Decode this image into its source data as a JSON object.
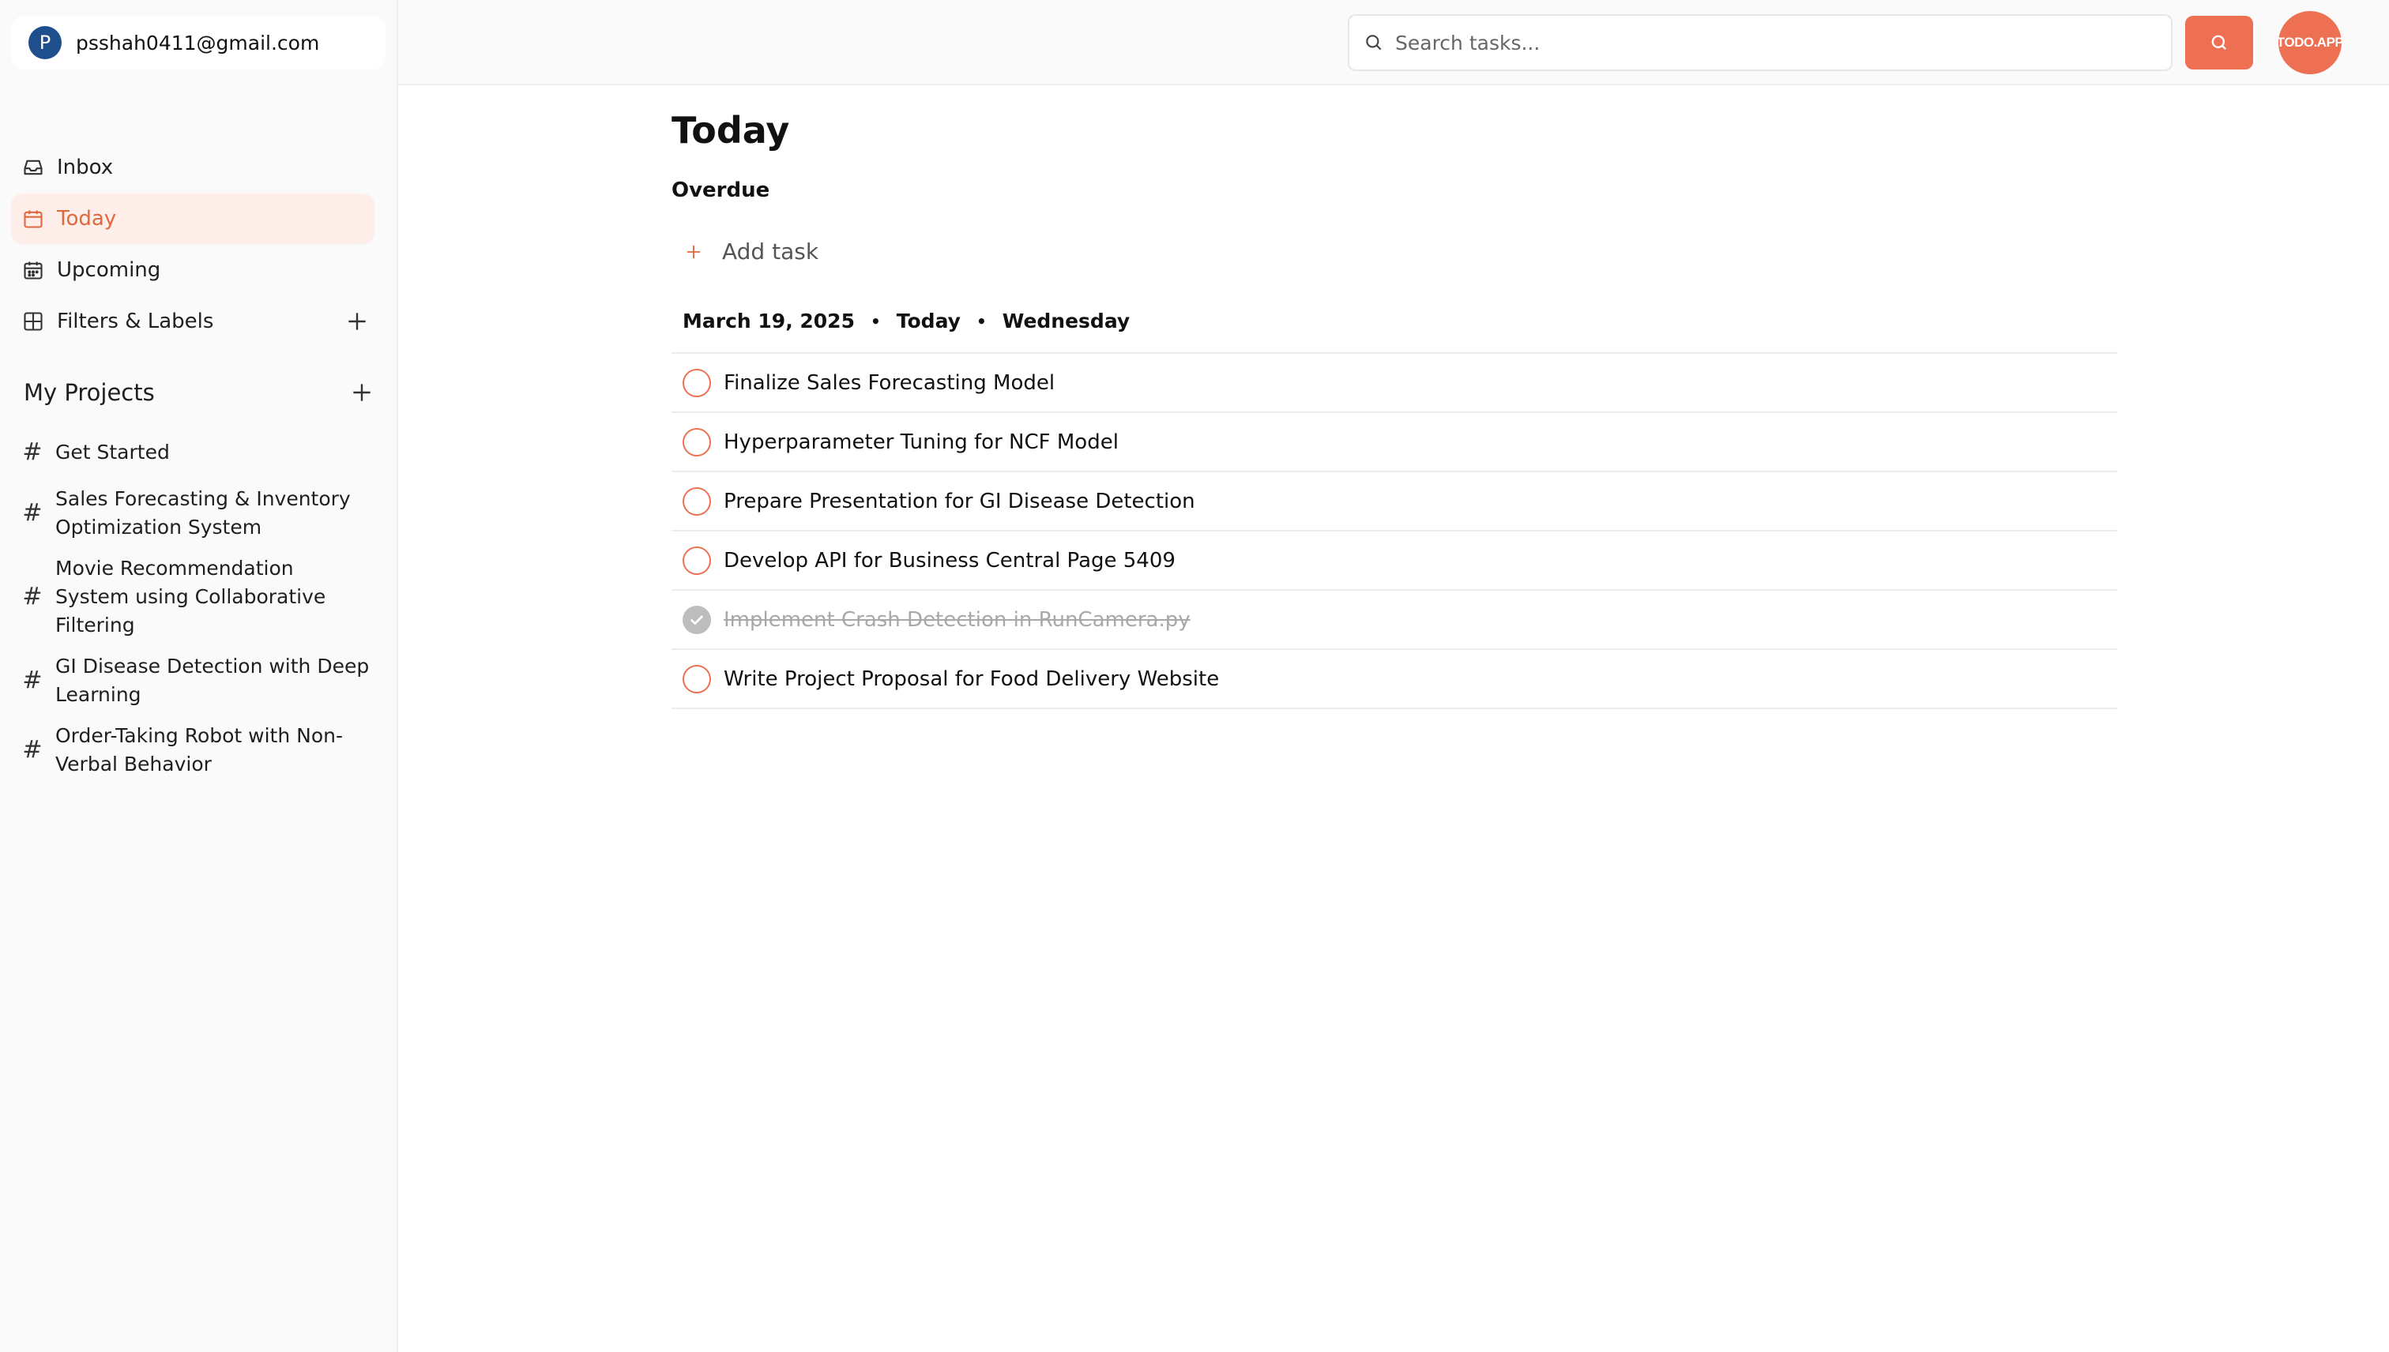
{
  "account": {
    "avatar_letter": "P",
    "email": "psshah0411@gmail.com"
  },
  "nav": {
    "items": [
      {
        "label": "Inbox",
        "icon": "inbox-icon"
      },
      {
        "label": "Today",
        "icon": "calendar-today-icon",
        "active": true
      },
      {
        "label": "Upcoming",
        "icon": "calendar-icon"
      },
      {
        "label": "Filters & Labels",
        "icon": "grid-icon"
      }
    ]
  },
  "projects": {
    "title": "My Projects",
    "items": [
      {
        "label": "Get Started"
      },
      {
        "label": "Sales Forecasting & Inventory Optimization System"
      },
      {
        "label": "Movie Recommendation System using Collaborative Filtering"
      },
      {
        "label": "GI Disease Detection with Deep Learning"
      },
      {
        "label": "Order-Taking Robot with Non-Verbal Behavior"
      }
    ]
  },
  "topbar": {
    "search_placeholder": "Search tasks...",
    "brand": "TODO.APP"
  },
  "main": {
    "title": "Today",
    "overdue_label": "Overdue",
    "add_task_label": "Add task",
    "date": {
      "date": "March 19, 2025",
      "relative": "Today",
      "weekday": "Wednesday",
      "separator": "•"
    },
    "tasks": [
      {
        "label": "Finalize Sales Forecasting Model",
        "done": false
      },
      {
        "label": "Hyperparameter Tuning for NCF Model",
        "done": false
      },
      {
        "label": "Prepare Presentation for GI Disease Detection",
        "done": false
      },
      {
        "label": "Develop API for Business Central Page 5409",
        "done": false
      },
      {
        "label": "Implement Crash Detection in RunCamera.py",
        "done": true
      },
      {
        "label": "Write Project Proposal for Food Delivery Website",
        "done": false
      }
    ]
  },
  "colors": {
    "accent": "#ee7053",
    "active_bg": "#fdeee9",
    "avatar": "#1f4e8c"
  }
}
